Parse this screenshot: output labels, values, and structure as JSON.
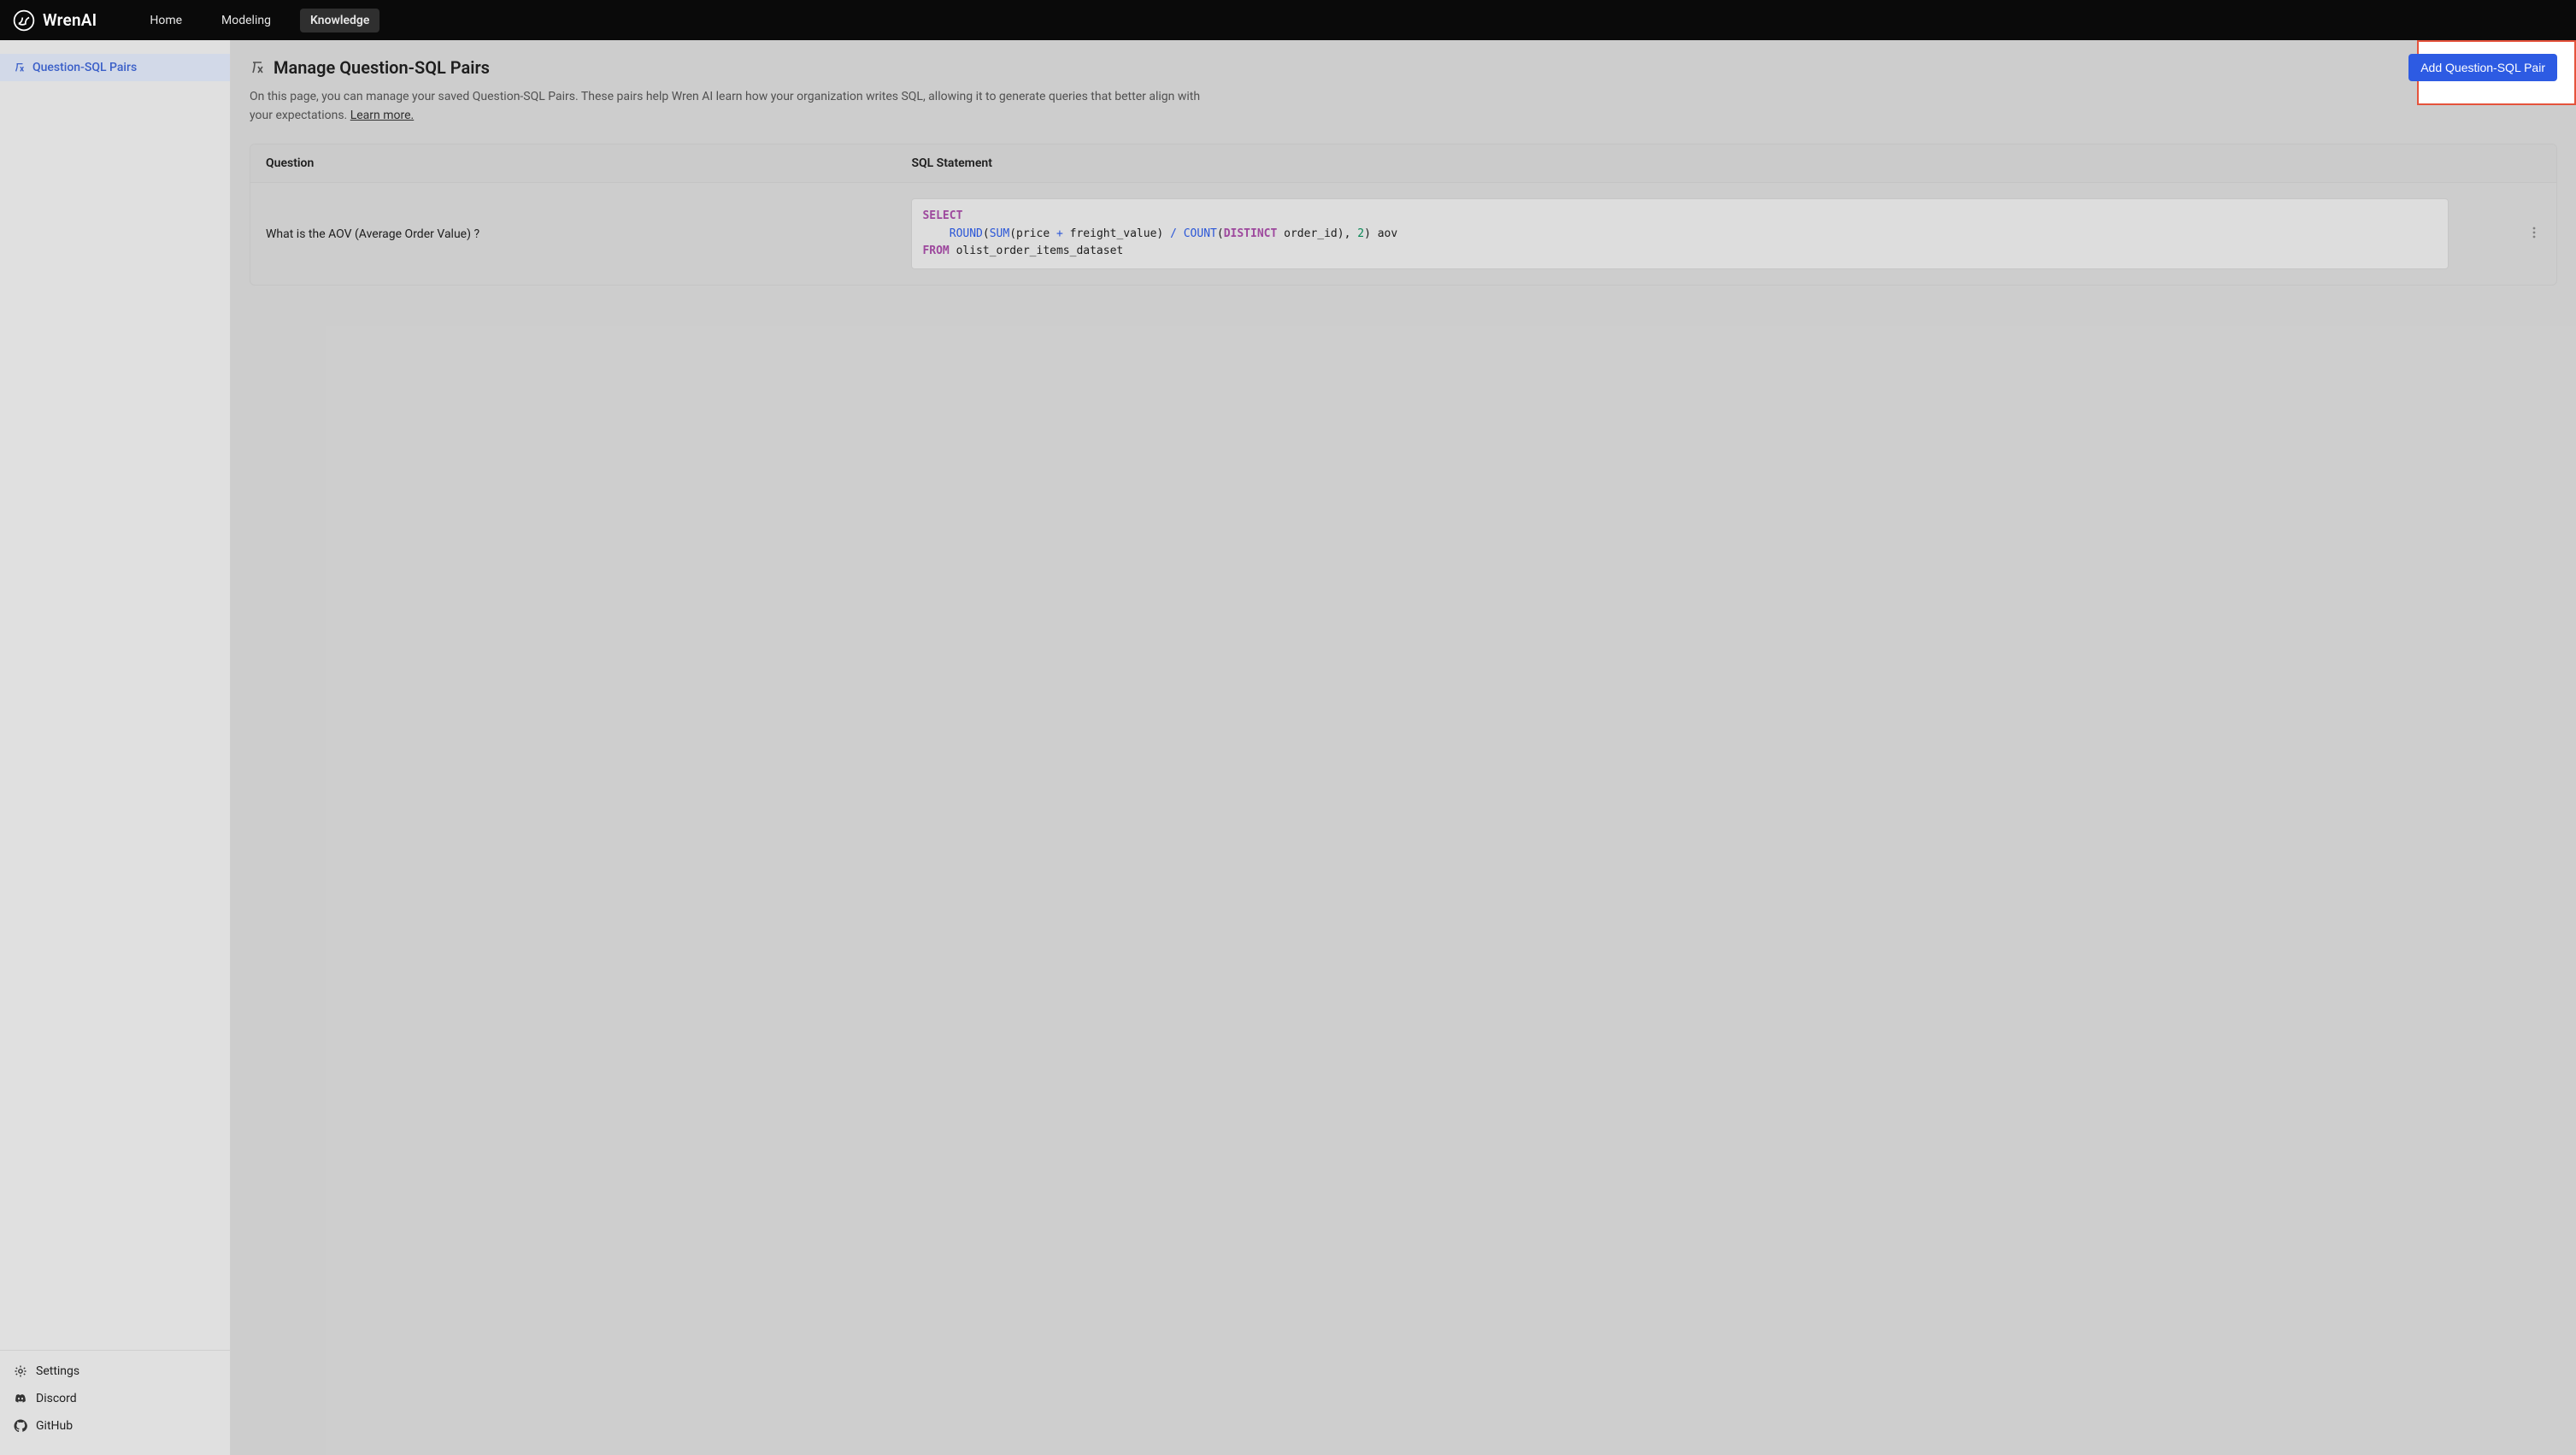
{
  "brand": "WrenAI",
  "nav": {
    "home": "Home",
    "modeling": "Modeling",
    "knowledge": "Knowledge"
  },
  "sidebar": {
    "items": [
      {
        "label": "Question-SQL Pairs"
      }
    ],
    "footer": {
      "settings": "Settings",
      "discord": "Discord",
      "github": "GitHub"
    }
  },
  "page": {
    "title": "Manage Question-SQL Pairs",
    "description": "On this page, you can manage your saved Question-SQL Pairs. These pairs help Wren AI learn how your organization writes SQL, allowing it to generate queries that better align with your expectations. ",
    "learn_more": "Learn more.",
    "add_button": "Add Question-SQL Pair"
  },
  "table": {
    "columns": {
      "question": "Question",
      "sql": "SQL Statement"
    },
    "rows": [
      {
        "question": "What is the AOV (Average Order Value) ?",
        "sql": {
          "select": "SELECT",
          "round": "ROUND",
          "sum": "SUM",
          "count": "COUNT",
          "distinct": "DISTINCT",
          "from": "FROM",
          "expr1_open": "(",
          "expr_sum_args": "(price ",
          "plus": "+",
          "expr_sum_args2": " freight_value) ",
          "slash": "/",
          "space": " ",
          "count_args_open": "(",
          "count_args": " order_id), ",
          "two": "2",
          "close_alias": ") aov",
          "table": " olist_order_items_dataset"
        }
      }
    ]
  }
}
